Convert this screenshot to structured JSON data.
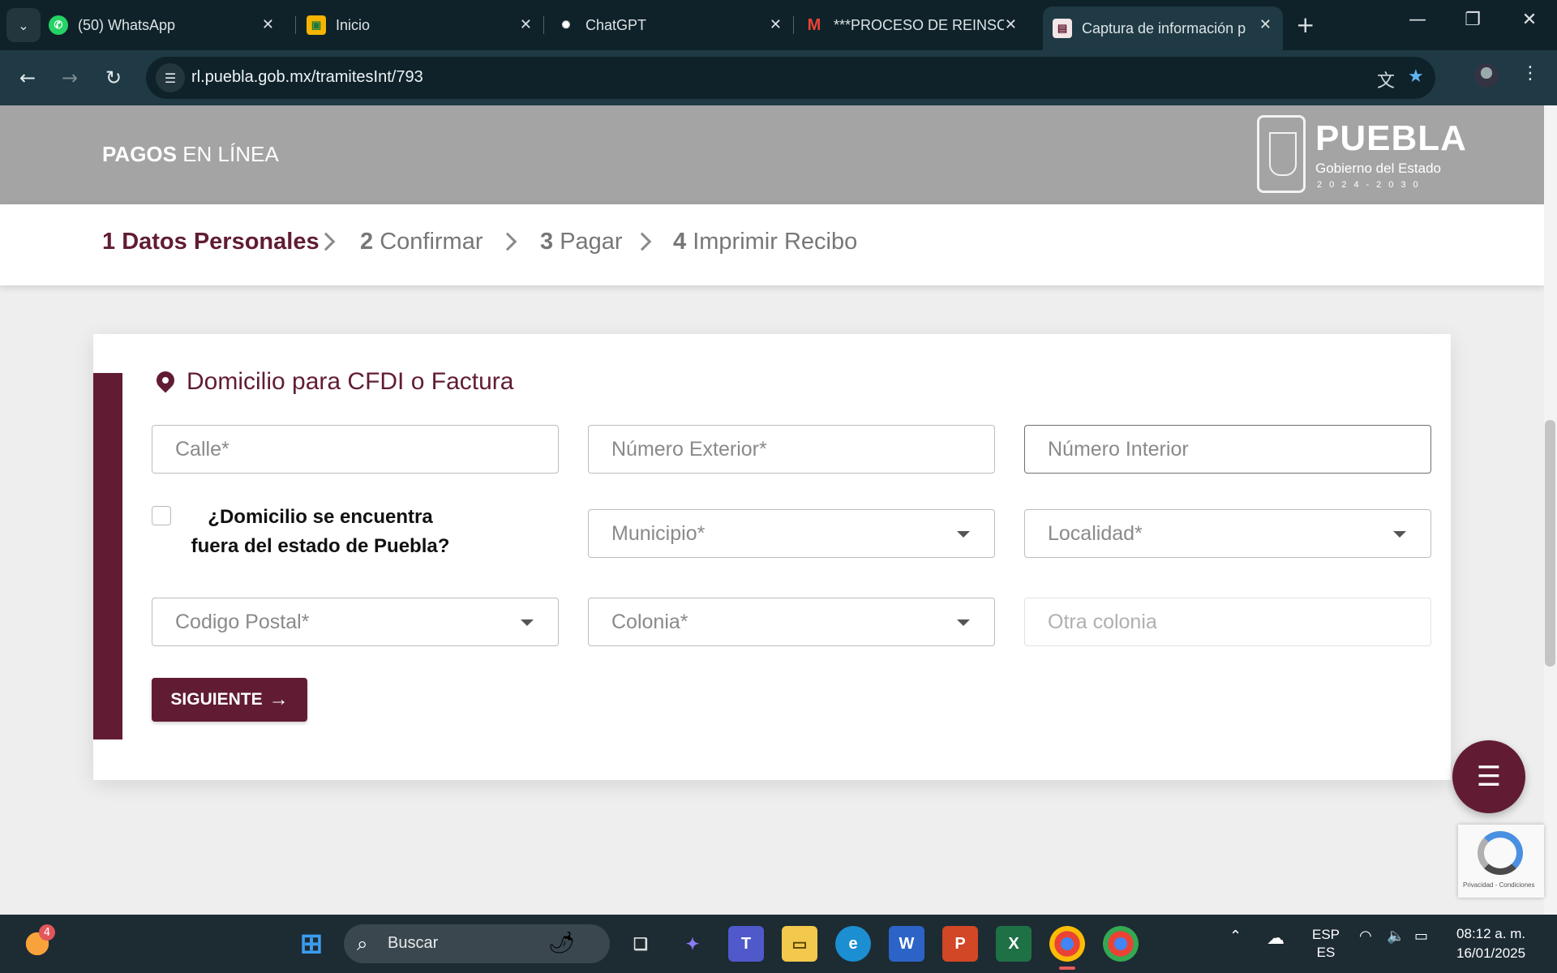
{
  "browser": {
    "tabs": [
      {
        "title": "(50) WhatsApp",
        "icon": "whatsapp-icon"
      },
      {
        "title": "Inicio",
        "icon": "classroom-icon"
      },
      {
        "title": "ChatGPT",
        "icon": "chatgpt-icon"
      },
      {
        "title": "***PROCESO DE REINSCR",
        "icon": "gmail-icon"
      },
      {
        "title": "Captura de información p",
        "icon": "site-icon"
      }
    ],
    "url": "rl.puebla.gob.mx/tramitesInt/793"
  },
  "header": {
    "brand_bold": "PAGOS",
    "brand_rest": " EN LÍNEA",
    "logo_name": "PUEBLA",
    "logo_sub": "Gobierno del Estado",
    "logo_years": "2024-2030"
  },
  "steps": [
    {
      "num": "1",
      "label": " Datos Personales"
    },
    {
      "num": "2",
      "label": " Confirmar"
    },
    {
      "num": "3",
      "label": " Pagar"
    },
    {
      "num": "4",
      "label": " Imprimir Recibo"
    }
  ],
  "form": {
    "title": "Domicilio para CFDI o Factura",
    "calle": "Calle*",
    "numero_exterior": "Número Exterior*",
    "numero_interior": "Número Interior",
    "fuera_estado_label": "¿Domicilio se encuentra fuera del estado de Puebla?",
    "municipio": "Municipio*",
    "localidad": "Localidad*",
    "codigo_postal": "Codigo Postal*",
    "colonia": "Colonia*",
    "otra_colonia": "Otra colonia",
    "submit_label": "SIGUIENTE"
  },
  "recaptcha": {
    "text": "Privacidad - Condiciones"
  },
  "taskbar": {
    "search_placeholder": "Buscar",
    "notification_count": "4",
    "lang_top": "ESP",
    "lang_bottom": "ES",
    "time": "08:12 a. m.",
    "date": "16/01/2025"
  },
  "colors": {
    "brand": "#611c33",
    "header_bg": "#a4a4a4",
    "browser_bg": "#1f3a44"
  }
}
